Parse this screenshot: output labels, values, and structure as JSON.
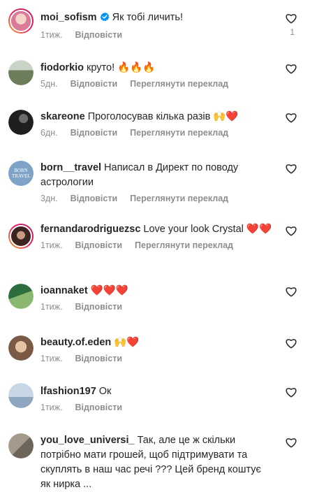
{
  "comments": [
    {
      "username": "moi_sofism",
      "verified": true,
      "text": "Як тобі личить!",
      "time": "1тиж.",
      "reply": "Відповісти",
      "translate": "",
      "likes": "1",
      "avatar_color": "#e8a2b8"
    },
    {
      "username": "fiodorkio",
      "text": "круто! 🔥🔥🔥",
      "time": "5дн.",
      "reply": "Відповісти",
      "translate": "Переглянути переклад",
      "avatar_color": "#6b7d5a"
    },
    {
      "username": "skareone",
      "text": "Проголосував кілька разів 🙌❤️",
      "time": "6дн.",
      "reply": "Відповісти",
      "translate": "Переглянути переклад",
      "avatar_color": "#2b2b2b"
    },
    {
      "username": "born__travel",
      "text": "Написал в Директ по поводу астрологии",
      "time": "3дн.",
      "reply": "Відповісти",
      "translate": "Переглянути переклад",
      "avatar_color": "#7fa3c8",
      "avatar_text": "BORN TRAVEL"
    },
    {
      "username": "fernandarodriguezsc",
      "text": "Love your look Crystal ❤️❤️",
      "time": "1тиж.",
      "reply": "Відповісти",
      "translate": "Переглянути переклад",
      "avatar_color": "#5a3b33"
    },
    {
      "username": "ioannaket",
      "text": "❤️❤️❤️",
      "time": "1тиж.",
      "reply": "Відповісти",
      "translate": "",
      "avatar_color": "#4b8a55"
    },
    {
      "username": "beauty.of.eden",
      "text": "🙌❤️",
      "time": "1тиж.",
      "reply": "Відповісти",
      "translate": "",
      "avatar_color": "#c9a07a"
    },
    {
      "username": "lfashion197",
      "text": "Ок",
      "time": "1тиж.",
      "reply": "Відповісти",
      "translate": "",
      "avatar_color": "#a9b7c8"
    },
    {
      "username": "you_love_universi_",
      "text": "Так, але це ж скільки потрібно мати грошей, щоб підтримувати та скуплять в наш час речі ??? Цей бренд коштує як нирка ...",
      "time": "",
      "reply": "",
      "translate": "",
      "avatar_color": "#8a8072"
    }
  ],
  "colors": {
    "text": "#262626",
    "muted": "#8e8e8e",
    "verified": "#0095f6"
  }
}
